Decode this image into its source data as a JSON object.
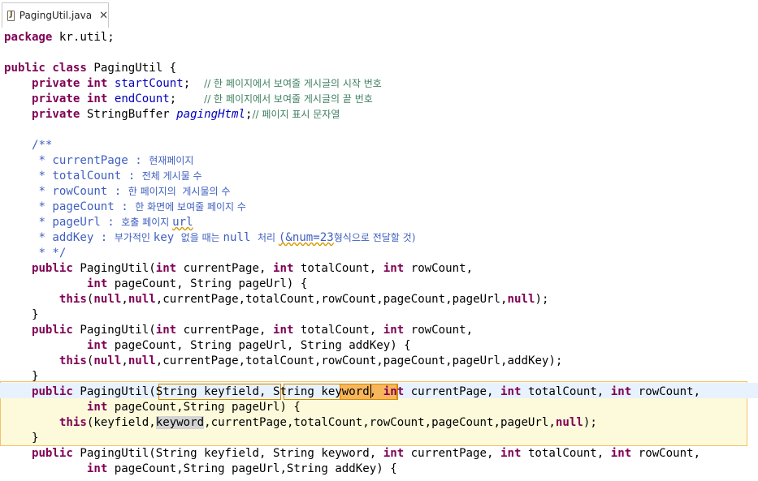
{
  "tab": {
    "file_name": "PagingUtil.java",
    "close_glyph": "✕"
  },
  "code": {
    "l1_package": "package",
    "l1_pkg_name": " kr.util;",
    "l3_public": "public",
    "l3_class": "class",
    "l3_name": " PagingUtil {",
    "l4_private": "private",
    "l4_int": "int",
    "l4_field": "startCount",
    "l4_semi": ";  ",
    "l4_comment": "// 한 페이지에서 보여줄 게시글의 시작 번호",
    "l5_private": "private",
    "l5_int": "int",
    "l5_field": "endCount",
    "l5_semi": ";    ",
    "l5_comment": "// 한 페이지에서 보여줄 게시글의 끝 번호",
    "l6_private": "private",
    "l6_type": " StringBuffer ",
    "l6_field": "pagingHtml",
    "l6_semi": ";",
    "l6_comment": "// 페이지 표시 문자열",
    "l8_jd": "/**",
    "l9_jd": " * currentPage : ",
    "l9_ko": "현재페이지",
    "l10_jd": " * totalCount : ",
    "l10_ko": "전체 게시물 수",
    "l11_jd": " * rowCount : ",
    "l11_ko": "한 페이지의  게시물의 수",
    "l12_jd": " * pageCount : ",
    "l12_ko": "한 화면에 보여줄 페이지 수",
    "l13_jd": " * pageUrl : ",
    "l13_ko": "호출 페이지 ",
    "l13_url": "url",
    "l14_jd1": " * addKey : ",
    "l14_ko1": "부가적인 ",
    "l14_jd2": "key ",
    "l14_ko2": "없을 때는 ",
    "l14_jd3": "null ",
    "l14_ko3": "처리 ",
    "l14_jd4": "(&num=23",
    "l14_ko4": "형식으로 전달할 것)",
    "l15_jd": " * */",
    "c1_public": "public",
    "c1_name": " PagingUtil(",
    "c1_int1": "int",
    "c1_p1": " currentPage, ",
    "c1_int2": "int",
    "c1_p2": " totalCount, ",
    "c1_int3": "int",
    "c1_p3": " rowCount,",
    "c1b_indent": "        ",
    "c1b_int": "int",
    "c1b_rest": " pageCount, String pageUrl) {",
    "c1c_indent": "    ",
    "c1c_this": "this",
    "c1c_open": "(",
    "c1c_null1": "null",
    "c1c_comma1": ",",
    "c1c_null2": "null",
    "c1c_args": ",currentPage,totalCount,rowCount,pageCount,pageUrl,",
    "c1c_null3": "null",
    "c1c_end": ");",
    "c1_close": "}",
    "c2_public": "public",
    "c2_name": " PagingUtil(",
    "c2_int1": "int",
    "c2_p1": " currentPage, ",
    "c2_int2": "int",
    "c2_p2": " totalCount, ",
    "c2_int3": "int",
    "c2_p3": " rowCount,",
    "c2b_indent": "        ",
    "c2b_int": "int",
    "c2b_rest": " pageCount, String pageUrl, String addKey) {",
    "c2c_indent": "    ",
    "c2c_this": "this",
    "c2c_open": "(",
    "c2c_null1": "null",
    "c2c_comma1": ",",
    "c2c_null2": "null",
    "c2c_args": ",currentPage,totalCount,rowCount,pageCount,pageUrl,addKey);",
    "c2_close": "}",
    "c3_public": "public",
    "c3_name": " PagingUtil",
    "c3_p_a": "(String keyfield,",
    "c3_p_b": " String keyword,",
    "c3_int1": "int",
    "c3_p1": " currentPage, ",
    "c3_int2": "int",
    "c3_p2": " totalCount, ",
    "c3_int3": "int",
    "c3_p3": " rowCount,",
    "c3b_indent": "        ",
    "c3b_int": "int",
    "c3b_rest": " pageCount,String pageUrl) {",
    "c3c_indent": "    ",
    "c3c_this": "this",
    "c3c_a": "(keyfield,",
    "c3c_kw": "keyword",
    "c3c_args": ",currentPage,totalCount,rowCount,pageCount,pageUrl,",
    "c3c_null": "null",
    "c3c_end": ");",
    "c3_close": "}",
    "c4_public": "public",
    "c4_name": " PagingUtil(String keyfield, String keyword, ",
    "c4_int1": "int",
    "c4_p1": " currentPage, ",
    "c4_int2": "int",
    "c4_p2": " totalCount, ",
    "c4_int3": "int",
    "c4_p3": " rowCount,",
    "c4b_indent": "        ",
    "c4b_int": "int",
    "c4b_rest": " pageCount,String pageUrl,String addKey) {"
  }
}
